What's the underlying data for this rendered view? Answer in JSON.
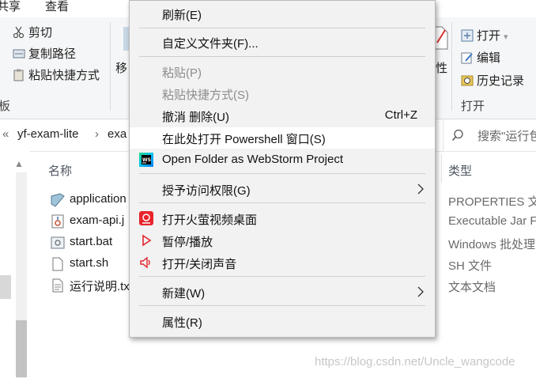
{
  "ribbon": {
    "tabs": [
      "共享",
      "查看"
    ],
    "clipboard": {
      "cut": "剪切",
      "copy_path": "复制路径",
      "paste_shortcut": "粘贴快捷方式",
      "group": "板",
      "move": "移"
    },
    "open": {
      "open": "打开",
      "edit": "编辑",
      "history": "历史记录",
      "group": "打开",
      "props_fragment": "性"
    }
  },
  "address": {
    "crumbs": [
      "yf-exam-lite",
      "exa"
    ],
    "search_placeholder": "搜索\"运行包"
  },
  "columns": {
    "name": "名称",
    "type": "类型"
  },
  "files": [
    {
      "name": "application",
      "type": "PROPERTIES 文件",
      "icon": "properties-file-icon"
    },
    {
      "name": "exam-api.j",
      "type": "Executable Jar F",
      "icon": "jar-file-icon"
    },
    {
      "name": "start.bat",
      "type": "Windows 批处理",
      "icon": "bat-file-icon"
    },
    {
      "name": "start.sh",
      "type": "SH 文件",
      "icon": "sh-file-icon"
    },
    {
      "name": "运行说明.tx",
      "type": "文本文档",
      "icon": "txt-file-icon"
    }
  ],
  "menu": {
    "refresh": "刷新(E)",
    "custom_folder": "自定义文件夹(F)...",
    "paste": "粘贴(P)",
    "paste_shortcut": "粘贴快捷方式(S)",
    "undo_delete": "撤消 删除(U)",
    "undo_shortcut": "Ctrl+Z",
    "open_powershell": "在此处打开 Powershell 窗口(S)",
    "open_webstorm": "Open Folder as WebStorm Project",
    "grant_access": "授予访问权限(G)",
    "firefly": "打开火萤视频桌面",
    "pause_play": "暂停/播放",
    "toggle_sound": "打开/关闭声音",
    "new": "新建(W)",
    "properties": "属性(R)"
  },
  "watermark": "https://blog.csdn.net/Uncle_wangcode"
}
